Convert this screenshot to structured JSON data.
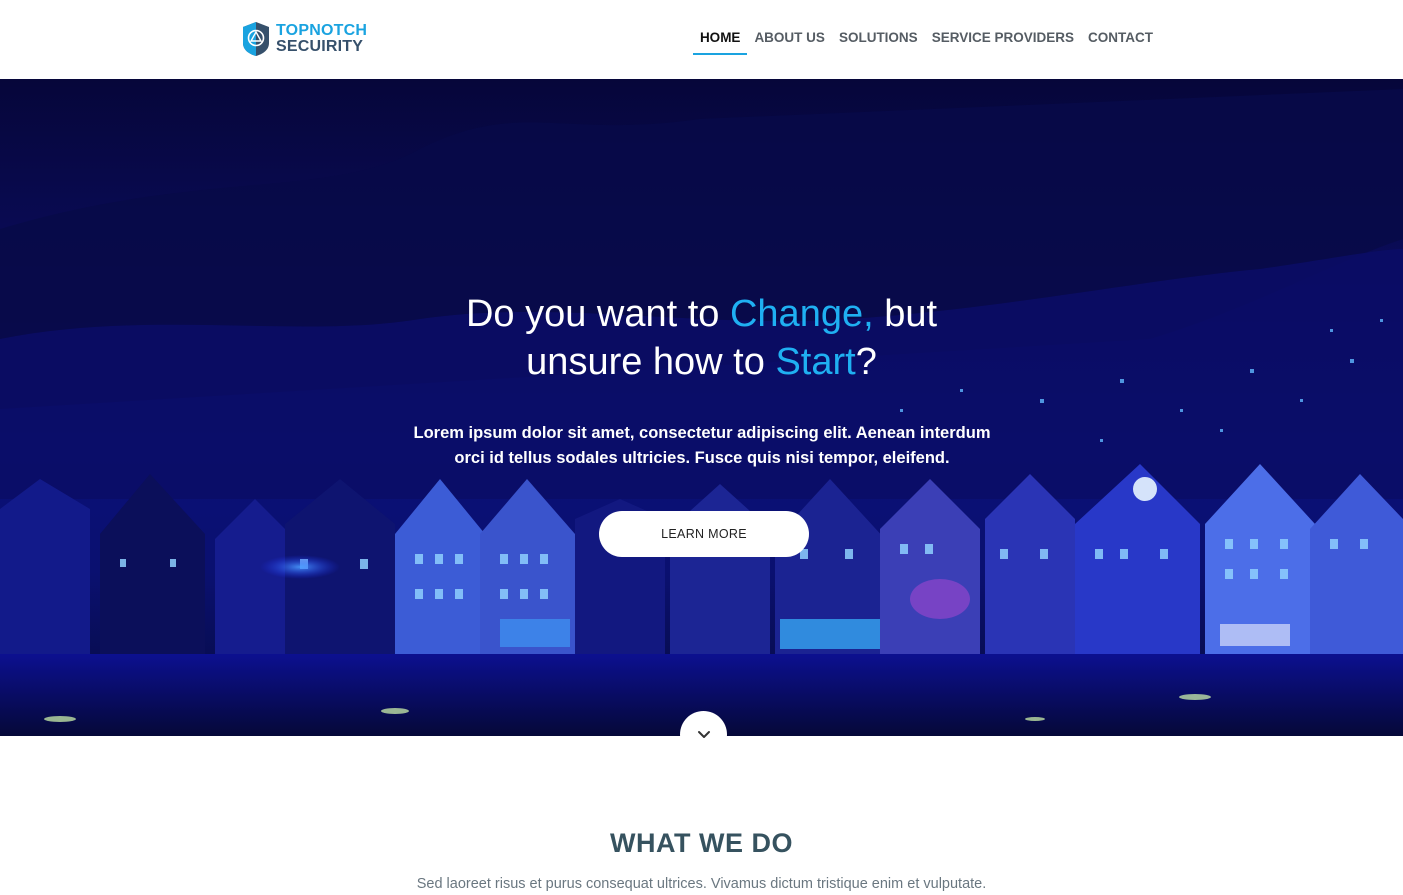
{
  "brand": {
    "line1": "TOPNOTCH",
    "line2": "SECUIRITY",
    "icon": "shield-logo-icon",
    "primary_color": "#1aa3e0",
    "dark_color": "#36506b"
  },
  "nav": {
    "items": [
      {
        "label": "HOME",
        "active": true
      },
      {
        "label": "ABOUT US",
        "active": false
      },
      {
        "label": "SOLUTIONS",
        "active": false
      },
      {
        "label": "SERVICE PROVIDERS",
        "active": false
      },
      {
        "label": "CONTACT",
        "active": false
      }
    ]
  },
  "hero": {
    "title_part1": "Do you want to ",
    "title_highlight1": "Change,",
    "title_part2": " but",
    "title_part3": "unsure how to ",
    "title_highlight2": "Start",
    "title_part4": "?",
    "text": "Lorem ipsum dolor sit amet, consectetur adipiscing elit. Aenean interdum orci id tellus sodales ultricies. Fusce quis nisi tempor, eleifend.",
    "button_label": "LEARN MORE",
    "scroll_icon": "chevron-down-icon",
    "highlight_color": "#1fb0f2"
  },
  "section": {
    "title": "WHAT WE DO",
    "subtitle": "Sed laoreet risus et purus consequat ultrices. Vivamus dictum tristique enim et vulputate."
  }
}
